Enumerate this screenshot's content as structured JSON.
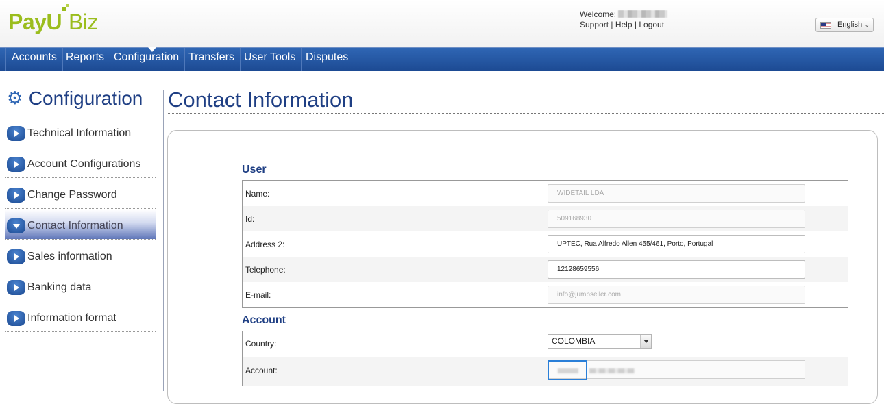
{
  "header": {
    "logo": {
      "left": "PayU",
      "right": "Biz"
    },
    "welcome_label": "Welcome:",
    "links": {
      "support": "Support",
      "help": "Help",
      "logout": "Logout",
      "separator": "|"
    },
    "language": "English"
  },
  "nav": {
    "items": [
      {
        "label": "Accounts"
      },
      {
        "label": "Reports"
      },
      {
        "label": "Configuration",
        "active": true
      },
      {
        "label": "Transfers"
      },
      {
        "label": "User Tools"
      },
      {
        "label": "Disputes"
      }
    ]
  },
  "sidebar": {
    "title": "Configuration",
    "items": [
      {
        "label": "Technical Information"
      },
      {
        "label": "Account Configurations"
      },
      {
        "label": "Change Password"
      },
      {
        "label": "Contact Information",
        "active": true
      },
      {
        "label": "Sales information"
      },
      {
        "label": "Banking data"
      },
      {
        "label": "Information format"
      }
    ]
  },
  "main": {
    "title": "Contact Information",
    "user_section": {
      "title": "User",
      "fields": [
        {
          "label": "Name:",
          "value": "WIDETAIL LDA",
          "disabled": true
        },
        {
          "label": "Id:",
          "value": "509168930",
          "disabled": true
        },
        {
          "label": "Address 2:",
          "value": "UPTEC, Rua Alfredo Allen 455/461, Porto, Portugal",
          "disabled": false
        },
        {
          "label": "Telephone:",
          "value": "12128659556",
          "disabled": false
        },
        {
          "label": "E-mail:",
          "value": "info@jumpseller.com",
          "disabled": true
        }
      ]
    },
    "account_section": {
      "title": "Account",
      "country_label": "Country:",
      "country_value": "COLOMBIA",
      "account_label": "Account:"
    }
  }
}
